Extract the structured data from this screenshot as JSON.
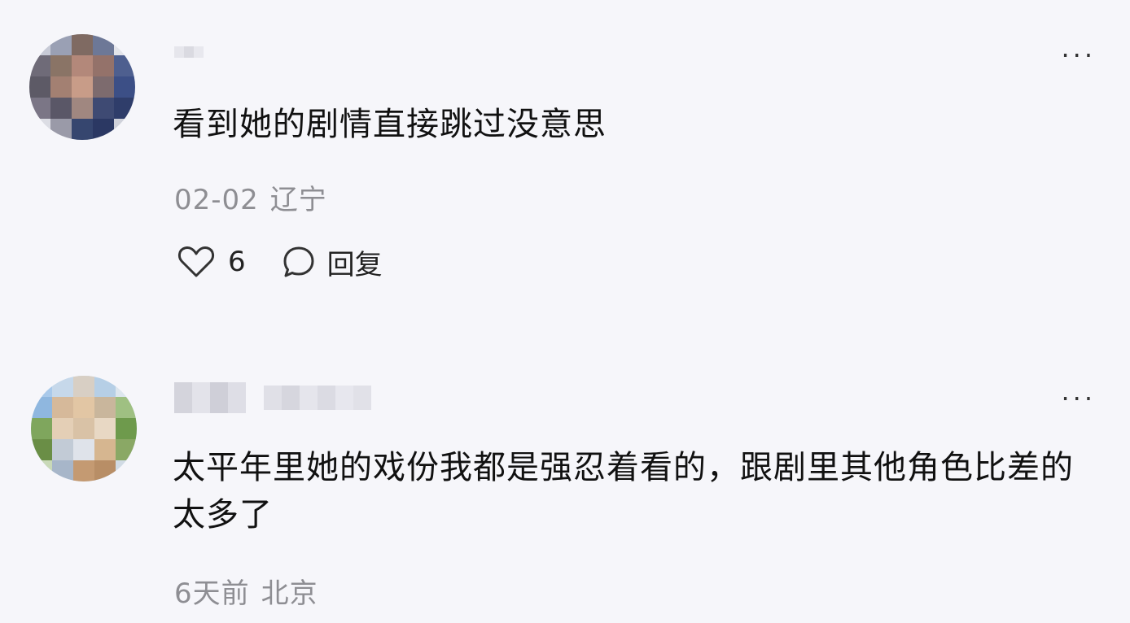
{
  "comments": [
    {
      "text": "看到她的剧情直接跳过没意思",
      "date": "02-02",
      "location": "辽宁",
      "like_icon": "heart-icon",
      "likes": "6",
      "reply_icon": "speech-bubble-icon",
      "reply_label": "回复",
      "more_label": "···"
    },
    {
      "text": "太平年里她的戏份我都是强忍着看的，跟剧里其他角色比差的太多了",
      "date": "6天前",
      "location": "北京",
      "more_label": "···"
    }
  ],
  "colors": {
    "background": "#f6f6fa",
    "text": "#111111",
    "meta": "#8e8e93"
  }
}
